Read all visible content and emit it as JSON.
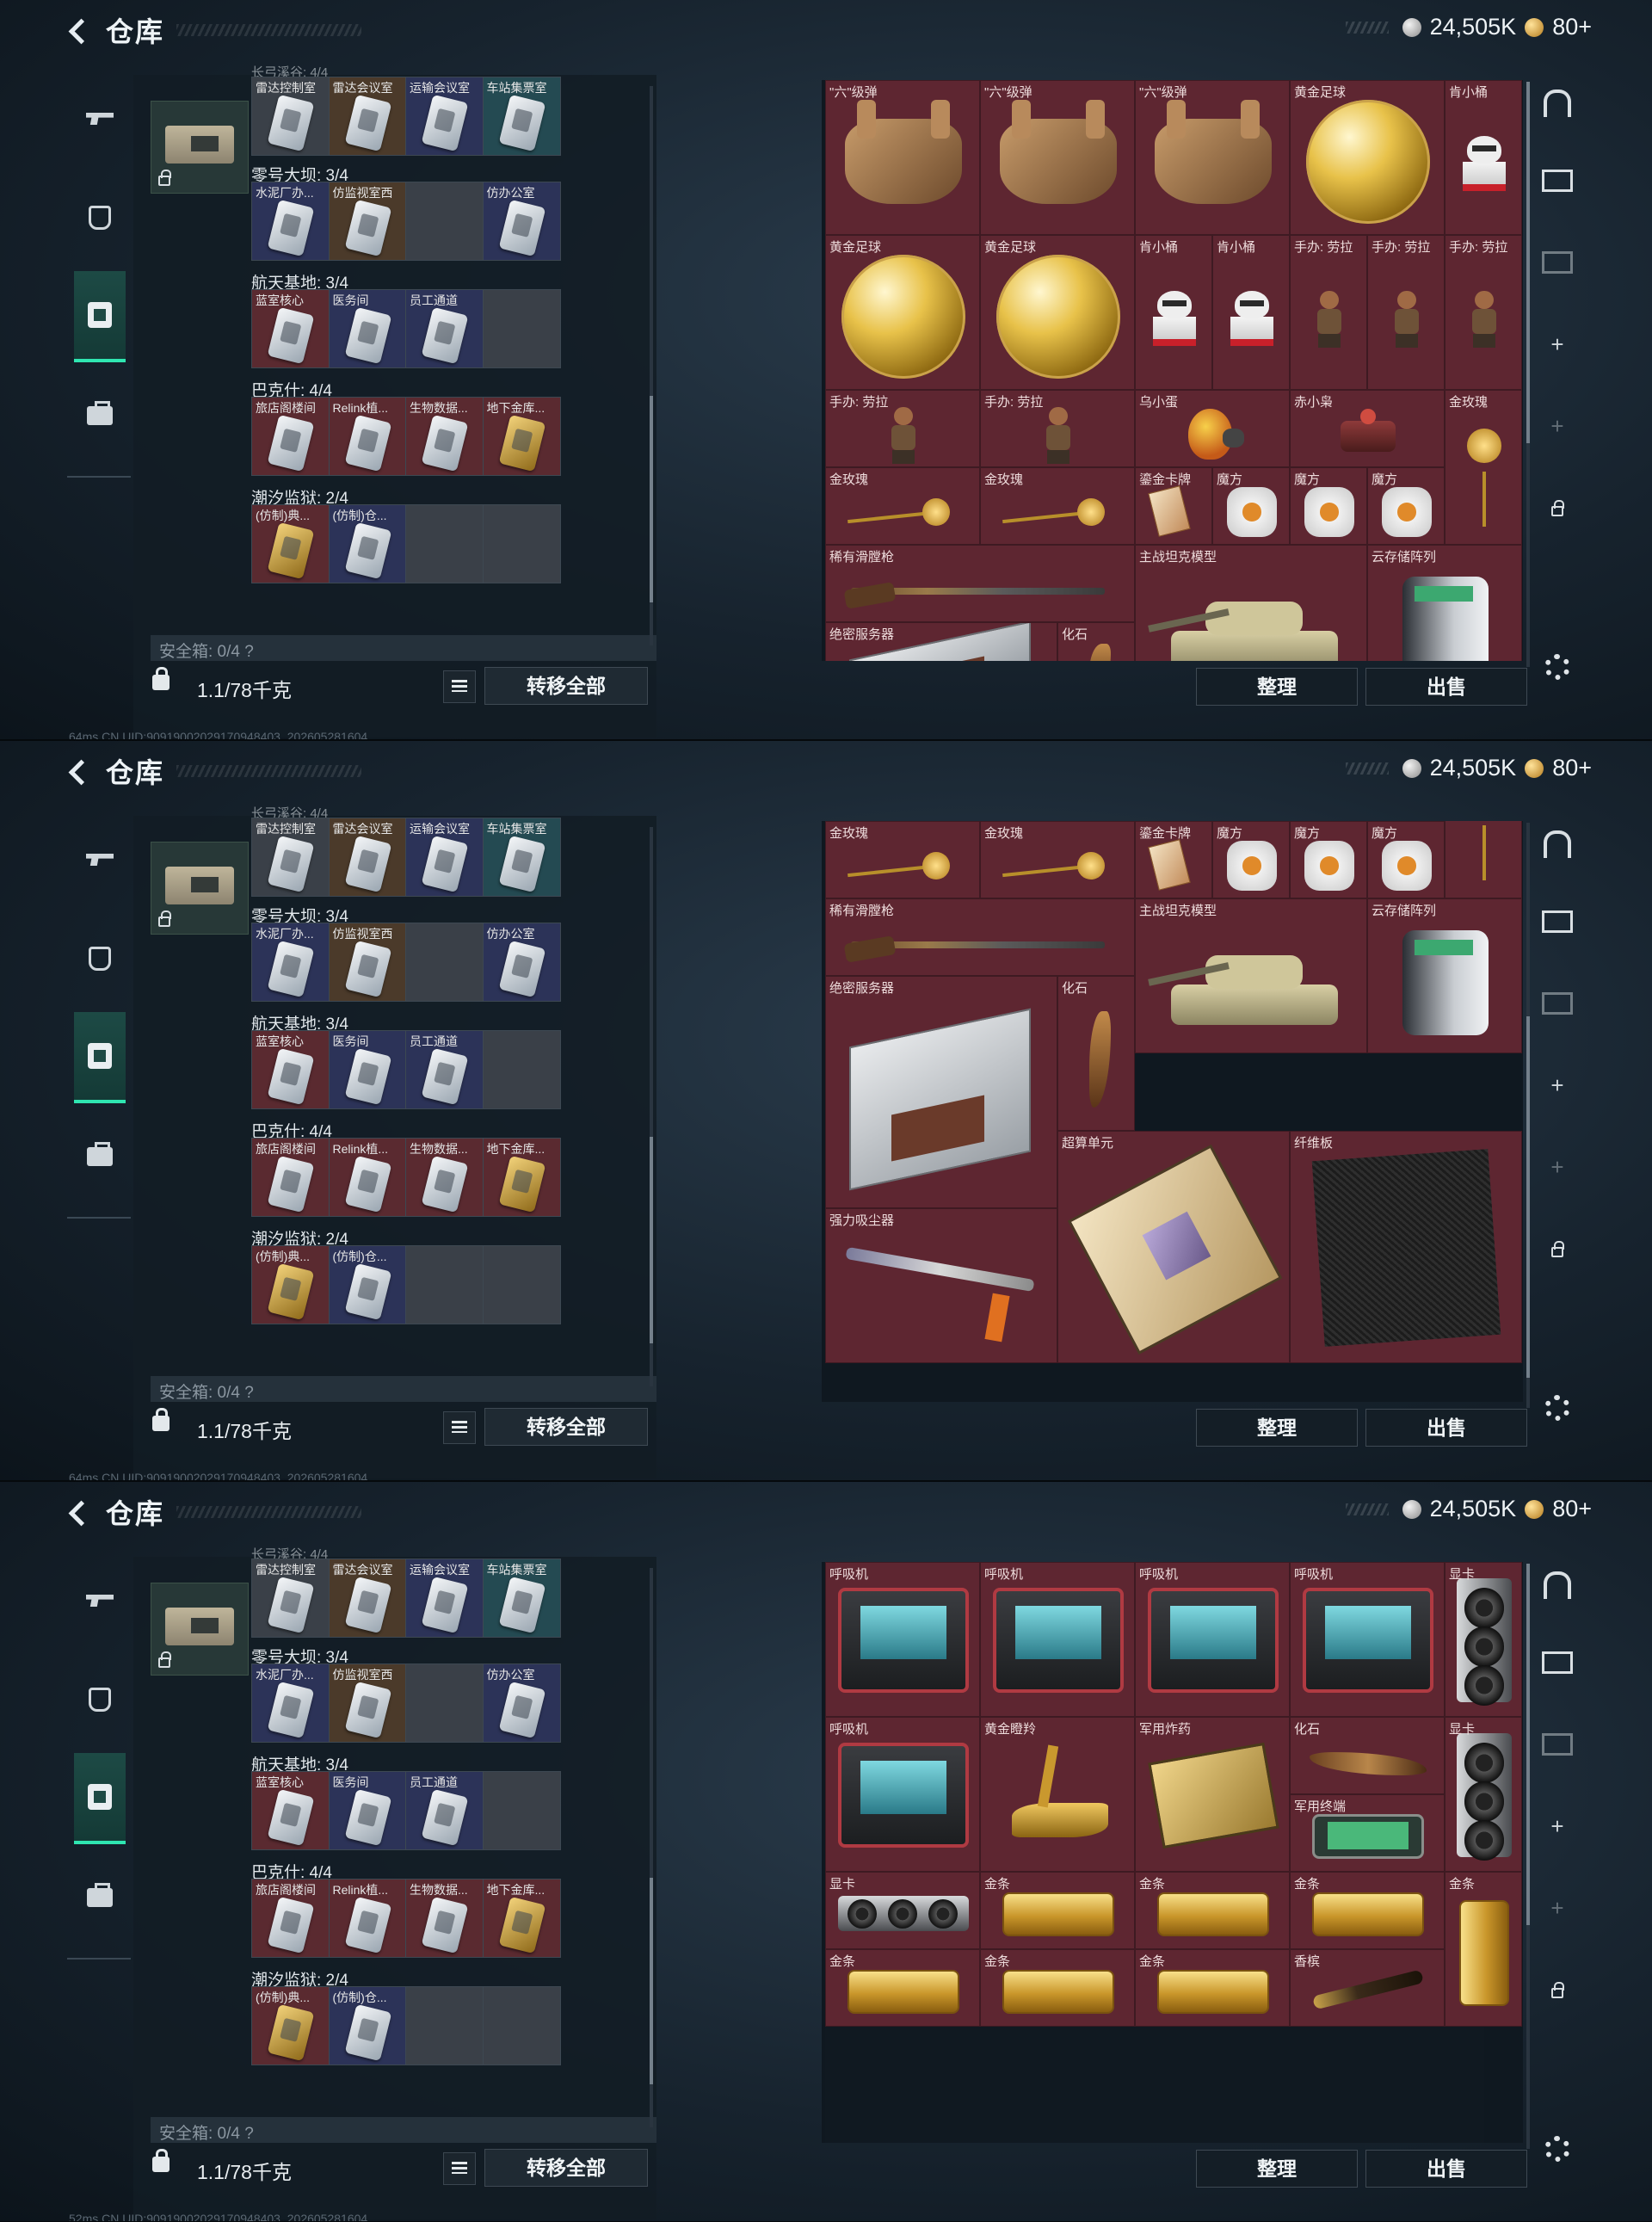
{
  "header": {
    "title": "仓库",
    "money": "24,505K",
    "coins": "80+"
  },
  "rail": [
    {
      "name": "weapon",
      "icon": "gun-icon"
    },
    {
      "name": "armor",
      "icon": "armor-icon"
    },
    {
      "name": "case",
      "icon": "keycard-case-icon",
      "active": true
    },
    {
      "name": "bag",
      "icon": "briefcase-icon"
    }
  ],
  "keycase": {
    "groups": [
      {
        "label": "长弓溪谷: 4/4",
        "cells": [
          {
            "label": "雷达控制室",
            "bg": "grey"
          },
          {
            "label": "雷达会议室",
            "bg": "brown"
          },
          {
            "label": "运输会议室",
            "bg": "blue"
          },
          {
            "label": "车站集票室",
            "bg": "teal"
          }
        ]
      },
      {
        "label": "零号大坝: 3/4",
        "cells": [
          {
            "label": "水泥厂办...",
            "bg": "blue"
          },
          {
            "label": "仿监视室西",
            "bg": "brown"
          },
          {
            "label": "",
            "bg": "grey"
          },
          {
            "label": "仿办公室",
            "bg": "blue"
          }
        ]
      },
      {
        "label": "航天基地: 3/4",
        "cells": [
          {
            "label": "蓝室核心",
            "bg": "red"
          },
          {
            "label": "医务间",
            "bg": "blue"
          },
          {
            "label": "员工通道",
            "bg": "blue"
          },
          {
            "label": "",
            "bg": "grey"
          }
        ]
      },
      {
        "label": "巴克什: 4/4",
        "cells": [
          {
            "label": "旅店阁楼间",
            "bg": "red"
          },
          {
            "label": "Relink植...",
            "bg": "red"
          },
          {
            "label": "生物数据...",
            "bg": "red"
          },
          {
            "label": "地下金库...",
            "bg": "red",
            "gold": true
          }
        ]
      },
      {
        "label": "潮汐监狱: 2/4",
        "cells": [
          {
            "label": "(仿制)典...",
            "bg": "red",
            "gold": true
          },
          {
            "label": "(仿制)仓...",
            "bg": "blue"
          },
          {
            "label": "",
            "bg": "grey"
          },
          {
            "label": "",
            "bg": "grey"
          }
        ]
      }
    ],
    "safe_box": "安全箱: 0/4 ?",
    "weight": "1.1/78千克",
    "transfer_all": "转移全部"
  },
  "status": [
    "64ms  CN UID:90919002029170948403_202605281604",
    "64ms  CN UID:90919002029170948403_202605281604",
    "52ms  CN UID:90919002029170948403_202605281604"
  ],
  "buttons": {
    "sort": "整理",
    "sell": "出售"
  },
  "shots": [
    {
      "items": [
        {
          "name": "\"六\"级弹",
          "c": 0,
          "r": 0,
          "w": 1,
          "h": 2,
          "vis": "glove"
        },
        {
          "name": "\"六\"级弹",
          "c": 1,
          "r": 0,
          "w": 1,
          "h": 2,
          "vis": "glove"
        },
        {
          "name": "\"六\"级弹",
          "c": 2,
          "r": 0,
          "w": 1,
          "h": 2,
          "vis": "glove"
        },
        {
          "name": "黄金足球",
          "c": 3,
          "r": 0,
          "w": 1,
          "h": 2,
          "vis": "ball"
        },
        {
          "name": "肯小桶",
          "c": 4,
          "r": 0,
          "w": 0.5,
          "h": 2,
          "vis": "bucket"
        },
        {
          "name": "黄金足球",
          "c": 0,
          "r": 2,
          "w": 1,
          "h": 2,
          "vis": "ball"
        },
        {
          "name": "黄金足球",
          "c": 1,
          "r": 2,
          "w": 1,
          "h": 2,
          "vis": "ball"
        },
        {
          "name": "肯小桶",
          "c": 2,
          "r": 2,
          "w": 0.5,
          "h": 2,
          "vis": "bucket"
        },
        {
          "name": "肯小桶",
          "c": 2.5,
          "r": 2,
          "w": 0.5,
          "h": 2,
          "vis": "bucket"
        },
        {
          "name": "手办: 劳拉",
          "c": 3,
          "r": 2,
          "w": 0.5,
          "h": 2,
          "vis": "figure"
        },
        {
          "name": "手办: 劳拉",
          "c": 3.5,
          "r": 2,
          "w": 0.5,
          "h": 2,
          "vis": "figure"
        },
        {
          "name": "手办: 劳拉",
          "c": 4,
          "r": 2,
          "w": 0.5,
          "h": 2,
          "vis": "figure"
        },
        {
          "name": "手办: 劳拉",
          "c": 0,
          "r": 4,
          "w": 1,
          "h": 1,
          "vis": "figure"
        },
        {
          "name": "手办: 劳拉",
          "c": 1,
          "r": 4,
          "w": 1,
          "h": 1,
          "vis": "figure"
        },
        {
          "name": "乌小蛋",
          "c": 2,
          "r": 4,
          "w": 1,
          "h": 1,
          "vis": "egg"
        },
        {
          "name": "赤小枭",
          "c": 3,
          "r": 4,
          "w": 1,
          "h": 1,
          "vis": "robot"
        },
        {
          "name": "金玫瑰",
          "c": 4,
          "r": 4,
          "w": 0.5,
          "h": 2,
          "vis": "rose"
        },
        {
          "name": "金玫瑰",
          "c": 0,
          "r": 5,
          "w": 1,
          "h": 1,
          "vis": "rose-h"
        },
        {
          "name": "金玫瑰",
          "c": 1,
          "r": 5,
          "w": 1,
          "h": 1,
          "vis": "rose-h"
        },
        {
          "name": "鎏金卡牌",
          "c": 2,
          "r": 5,
          "w": 0.5,
          "h": 1,
          "vis": "cards"
        },
        {
          "name": "魔方",
          "c": 2.5,
          "r": 5,
          "w": 0.5,
          "h": 1,
          "vis": "cube"
        },
        {
          "name": "魔方",
          "c": 3,
          "r": 5,
          "w": 0.5,
          "h": 1,
          "vis": "cube"
        },
        {
          "name": "魔方",
          "c": 3.5,
          "r": 5,
          "w": 0.5,
          "h": 1,
          "vis": "cube"
        },
        {
          "name": "稀有滑膛枪",
          "c": 0,
          "r": 6,
          "w": 2,
          "h": 1,
          "vis": "musket"
        },
        {
          "name": "主战坦克模型",
          "c": 2,
          "r": 6,
          "w": 1.5,
          "h": 2,
          "vis": "tank"
        },
        {
          "name": "云存储阵列",
          "c": 3.5,
          "r": 6,
          "w": 1,
          "h": 2,
          "vis": "server-tower"
        },
        {
          "name": "绝密服务器",
          "c": 0,
          "r": 7,
          "w": 1.5,
          "h": 1,
          "vis": "blade"
        },
        {
          "name": "化石",
          "c": 1.5,
          "r": 7,
          "w": 0.5,
          "h": 1,
          "vis": "fossil"
        }
      ]
    },
    {
      "items": [
        {
          "name": "",
          "c": 0,
          "r": -0.6,
          "w": 2,
          "h": 0.6,
          "vis": "none"
        },
        {
          "name": "",
          "c": 2,
          "r": -0.6,
          "w": 1,
          "h": 0.6,
          "vis": "none"
        },
        {
          "name": "",
          "c": 4,
          "r": -1,
          "w": 0.5,
          "h": 2,
          "vis": "rose"
        },
        {
          "name": "金玫瑰",
          "c": 0,
          "r": 0,
          "w": 1,
          "h": 1,
          "vis": "rose-h"
        },
        {
          "name": "金玫瑰",
          "c": 1,
          "r": 0,
          "w": 1,
          "h": 1,
          "vis": "rose-h"
        },
        {
          "name": "鎏金卡牌",
          "c": 2,
          "r": 0,
          "w": 0.5,
          "h": 1,
          "vis": "cards"
        },
        {
          "name": "魔方",
          "c": 2.5,
          "r": 0,
          "w": 0.5,
          "h": 1,
          "vis": "cube"
        },
        {
          "name": "魔方",
          "c": 3,
          "r": 0,
          "w": 0.5,
          "h": 1,
          "vis": "cube"
        },
        {
          "name": "魔方",
          "c": 3.5,
          "r": 0,
          "w": 0.5,
          "h": 1,
          "vis": "cube"
        },
        {
          "name": "稀有滑膛枪",
          "c": 0,
          "r": 1,
          "w": 2,
          "h": 1,
          "vis": "musket"
        },
        {
          "name": "主战坦克模型",
          "c": 2,
          "r": 1,
          "w": 1.5,
          "h": 2,
          "vis": "tank"
        },
        {
          "name": "云存储阵列",
          "c": 3.5,
          "r": 1,
          "w": 1,
          "h": 2,
          "vis": "server-tower"
        },
        {
          "name": "绝密服务器",
          "c": 0,
          "r": 2,
          "w": 1.5,
          "h": 3,
          "vis": "blade"
        },
        {
          "name": "化石",
          "c": 1.5,
          "r": 2,
          "w": 0.5,
          "h": 2,
          "vis": "fossil"
        },
        {
          "name": "超算单元",
          "c": 1.5,
          "r": 4,
          "w": 1.5,
          "h": 3,
          "vis": "board"
        },
        {
          "name": "纤维板",
          "c": 3,
          "r": 4,
          "w": 1.5,
          "h": 3,
          "vis": "fiber"
        },
        {
          "name": "强力吸尘器",
          "c": 0,
          "r": 5,
          "w": 1.5,
          "h": 2,
          "vis": "vacuum"
        }
      ]
    },
    {
      "items": [
        {
          "name": "呼吸机",
          "c": 0,
          "r": 0,
          "w": 1,
          "h": 2,
          "vis": "ventilator"
        },
        {
          "name": "呼吸机",
          "c": 1,
          "r": 0,
          "w": 1,
          "h": 2,
          "vis": "ventilator"
        },
        {
          "name": "呼吸机",
          "c": 2,
          "r": 0,
          "w": 1,
          "h": 2,
          "vis": "ventilator"
        },
        {
          "name": "呼吸机",
          "c": 3,
          "r": 0,
          "w": 1,
          "h": 2,
          "vis": "ventilator"
        },
        {
          "name": "显卡",
          "c": 4,
          "r": 0,
          "w": 0.5,
          "h": 2,
          "vis": "gpu-v"
        },
        {
          "name": "呼吸机",
          "c": 0,
          "r": 2,
          "w": 1,
          "h": 2,
          "vis": "ventilator"
        },
        {
          "name": "黄金瞪羚",
          "c": 1,
          "r": 2,
          "w": 1,
          "h": 2,
          "vis": "gazelle"
        },
        {
          "name": "军用炸药",
          "c": 2,
          "r": 2,
          "w": 1,
          "h": 2,
          "vis": "explosive"
        },
        {
          "name": "化石",
          "c": 3,
          "r": 2,
          "w": 1,
          "h": 1,
          "vis": "fossil-h"
        },
        {
          "name": "军用终端",
          "c": 3,
          "r": 3,
          "w": 1,
          "h": 1,
          "vis": "terminal"
        },
        {
          "name": "显卡",
          "c": 4,
          "r": 2,
          "w": 0.5,
          "h": 2,
          "vis": "gpu-v"
        },
        {
          "name": "显卡",
          "c": 0,
          "r": 4,
          "w": 1,
          "h": 1,
          "vis": "gpu-h"
        },
        {
          "name": "金条",
          "c": 1,
          "r": 4,
          "w": 1,
          "h": 1,
          "vis": "gold"
        },
        {
          "name": "金条",
          "c": 2,
          "r": 4,
          "w": 1,
          "h": 1,
          "vis": "gold"
        },
        {
          "name": "金条",
          "c": 3,
          "r": 4,
          "w": 1,
          "h": 1,
          "vis": "gold"
        },
        {
          "name": "金条",
          "c": 4,
          "r": 4,
          "w": 0.5,
          "h": 2,
          "vis": "gold-v"
        },
        {
          "name": "金条",
          "c": 0,
          "r": 5,
          "w": 1,
          "h": 1,
          "vis": "gold"
        },
        {
          "name": "金条",
          "c": 1,
          "r": 5,
          "w": 1,
          "h": 1,
          "vis": "gold"
        },
        {
          "name": "金条",
          "c": 2,
          "r": 5,
          "w": 1,
          "h": 1,
          "vis": "gold"
        },
        {
          "name": "香槟",
          "c": 3,
          "r": 5,
          "w": 1,
          "h": 1,
          "vis": "champagne"
        }
      ]
    }
  ]
}
